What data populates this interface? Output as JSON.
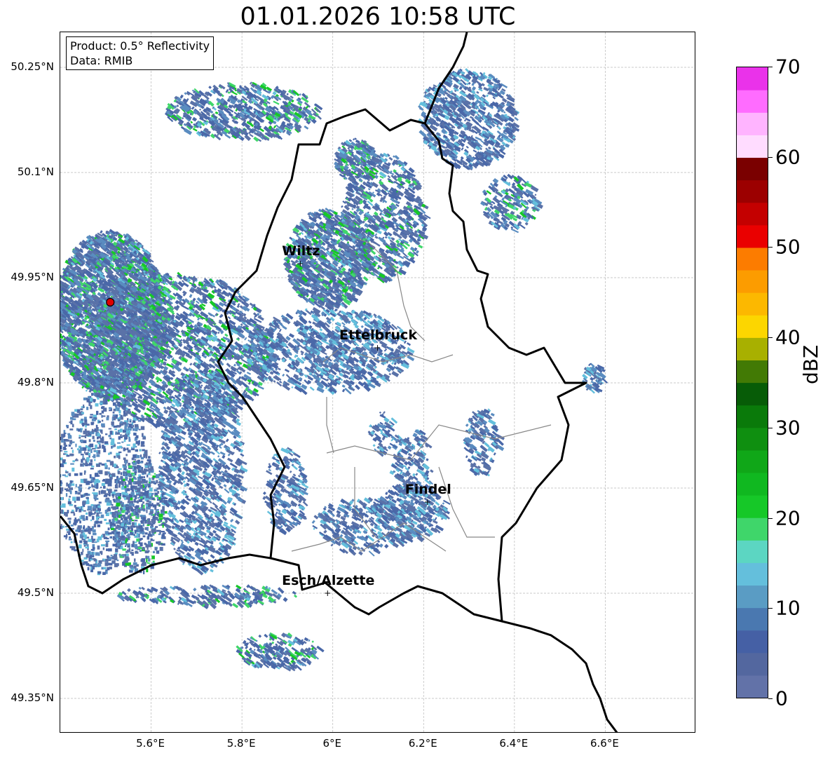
{
  "title": "01.01.2026 10:58 UTC",
  "info": {
    "product": "Product: 0.5° Reflectivity",
    "data_source": "Data: RMIB"
  },
  "axes": {
    "lat_labels": [
      {
        "value": 50.25,
        "label": "50.25°N"
      },
      {
        "value": 50.1,
        "label": "50.1°N"
      },
      {
        "value": 49.95,
        "label": "49.95°N"
      },
      {
        "value": 49.8,
        "label": "49.8°N"
      },
      {
        "value": 49.65,
        "label": "49.65°N"
      },
      {
        "value": 49.5,
        "label": "49.5°N"
      },
      {
        "value": 49.35,
        "label": "49.35°N"
      }
    ],
    "lon_labels": [
      {
        "value": 5.6,
        "label": "5.6°E"
      },
      {
        "value": 5.8,
        "label": "5.8°E"
      },
      {
        "value": 6.0,
        "label": "6°E"
      },
      {
        "value": 6.2,
        "label": "6.2°E"
      },
      {
        "value": 6.4,
        "label": "6.4°E"
      },
      {
        "value": 6.6,
        "label": "6.6°E"
      }
    ],
    "lon_range": [
      5.4,
      6.8
    ],
    "lat_range": [
      49.3,
      50.3
    ],
    "grid": true
  },
  "cities": [
    {
      "name": "Wiltz",
      "lon": 5.93,
      "lat": 49.97
    },
    {
      "name": "Ettelbruck",
      "lon": 6.1,
      "lat": 49.85
    },
    {
      "name": "Findel",
      "lon": 6.21,
      "lat": 49.63
    },
    {
      "name": "Esch/Alzette",
      "lon": 5.99,
      "lat": 49.5
    }
  ],
  "radar_site": {
    "lon": 5.51,
    "lat": 49.915,
    "color": "#e00000"
  },
  "colorbar": {
    "label": "dBZ",
    "min": 0,
    "max": 70,
    "ticks": [
      {
        "value": 0,
        "label": "0"
      },
      {
        "value": 10,
        "label": "10"
      },
      {
        "value": 20,
        "label": "20"
      },
      {
        "value": 30,
        "label": "30"
      },
      {
        "value": 40,
        "label": "40"
      },
      {
        "value": 50,
        "label": "50"
      },
      {
        "value": 60,
        "label": "60"
      },
      {
        "value": 70,
        "label": "70"
      }
    ],
    "colors": [
      "#6272a8",
      "#53679f",
      "#4560a5",
      "#4a78b0",
      "#5a9cc4",
      "#64bfdc",
      "#5cd6c2",
      "#3fd66a",
      "#16c828",
      "#10b820",
      "#10a718",
      "#0f8f10",
      "#0a7a0a",
      "#075c07",
      "#427a05",
      "#a8b000",
      "#fcd600",
      "#fcb800",
      "#fc9c00",
      "#fc7c00",
      "#ea0000",
      "#c40000",
      "#9c0000",
      "#7a0000",
      "#ffdcff",
      "#ffb4ff",
      "#ff6cff",
      "#ea32ea"
    ]
  },
  "echo_palette": [
    "#5a72a8",
    "#4a68a8",
    "#5a8cc0",
    "#64bfdc",
    "#5cd6c2",
    "#3fd66a",
    "#16c828",
    "#fcd600"
  ]
}
